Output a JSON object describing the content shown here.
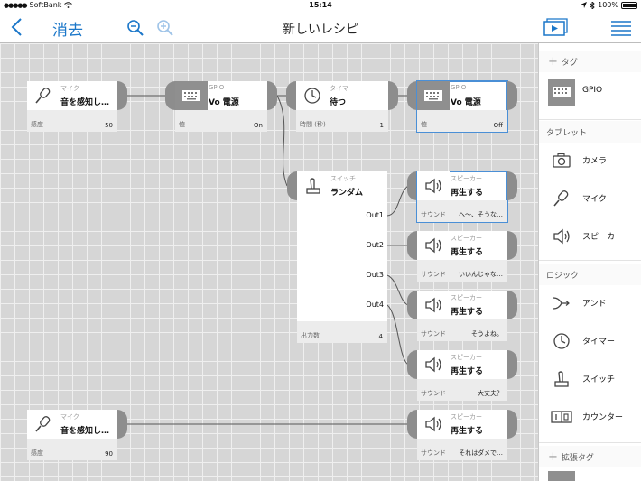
{
  "status_bar": {
    "signal": "●●●●●",
    "carrier": "SoftBank",
    "time": "15:14",
    "battery": "100%"
  },
  "nav": {
    "undo_label": "消去",
    "title": "新しいレシピ"
  },
  "nodes": {
    "mic1": {
      "category": "マイク",
      "action": "音を感知し…",
      "param_label": "感度",
      "param_value": "50"
    },
    "gpio1": {
      "category": "GPIO",
      "action": "Vo 電源",
      "param_label": "値",
      "param_value": "On"
    },
    "timer1": {
      "category": "タイマー",
      "action": "待つ",
      "param_label": "時間 (秒)",
      "param_value": "1"
    },
    "gpio2": {
      "category": "GPIO",
      "action": "Vo 電源",
      "param_label": "値",
      "param_value": "Off"
    },
    "switch1": {
      "category": "スイッチ",
      "action": "ランダム",
      "param_label": "出力数",
      "param_value": "4",
      "outputs": [
        "Out1",
        "Out2",
        "Out3",
        "Out4"
      ]
    },
    "spk1": {
      "category": "スピーカー",
      "action": "再生する",
      "param_label": "サウンド",
      "param_value": "へ～、そうな…"
    },
    "spk2": {
      "category": "スピーカー",
      "action": "再生する",
      "param_label": "サウンド",
      "param_value": "いいんじゃな…"
    },
    "spk3": {
      "category": "スピーカー",
      "action": "再生する",
      "param_label": "サウンド",
      "param_value": "そうよね。"
    },
    "spk4": {
      "category": "スピーカー",
      "action": "再生する",
      "param_label": "サウンド",
      "param_value": "大丈夫？"
    },
    "mic2": {
      "category": "マイク",
      "action": "音を感知し…",
      "param_label": "感度",
      "param_value": "90"
    },
    "spk5": {
      "category": "スピーカー",
      "action": "再生する",
      "param_label": "サウンド",
      "param_value": "それはダメで…"
    }
  },
  "sidebar": {
    "tags_title": "タグ",
    "gpio_label": "GPIO",
    "tablet_title": "タブレット",
    "tablet_items": [
      "カメラ",
      "マイク",
      "スピーカー"
    ],
    "logic_title": "ロジック",
    "logic_items": [
      "アンド",
      "タイマー",
      "スイッチ",
      "カウンター"
    ],
    "ext_title": "拡張タグ"
  },
  "colors": {
    "accent": "#1b77c9",
    "icon_gray": "#8f8f8f",
    "port": "#8d8d8d",
    "selected": "#4a8fd6"
  }
}
